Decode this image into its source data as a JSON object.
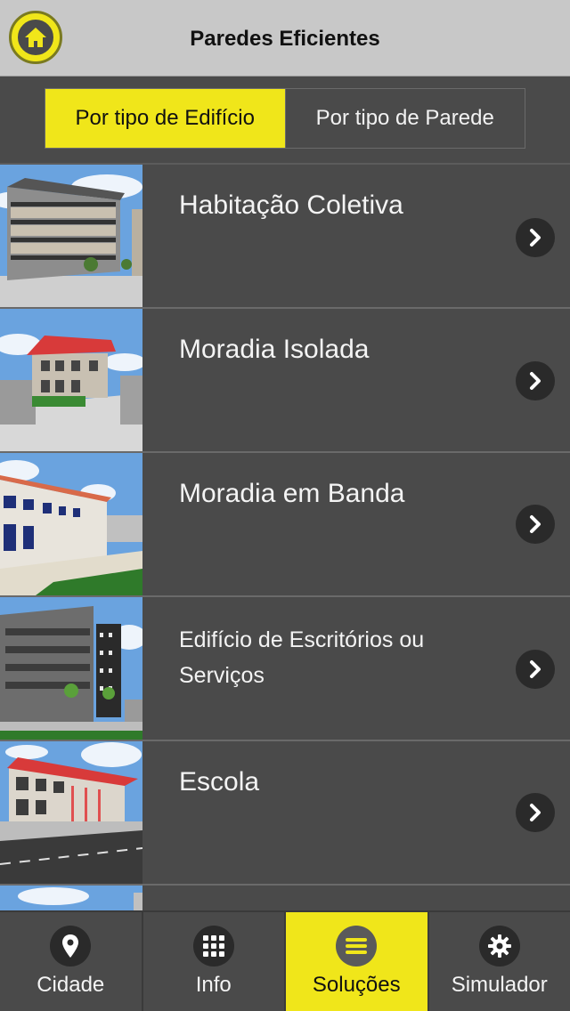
{
  "header": {
    "title": "Paredes Eficientes",
    "home_icon": "home-icon"
  },
  "segment": {
    "options": [
      {
        "label": "Por tipo de Edifício",
        "selected": true
      },
      {
        "label": "Por tipo de Parede",
        "selected": false
      }
    ]
  },
  "list": {
    "items": [
      {
        "label": "Habitação Coletiva",
        "thumb": "apartment-building"
      },
      {
        "label": "Moradia Isolada",
        "thumb": "detached-house"
      },
      {
        "label": "Moradia em Banda",
        "thumb": "row-houses"
      },
      {
        "label": "Edifício de Escritórios ou Serviços",
        "thumb": "office-building"
      },
      {
        "label": "Escola",
        "thumb": "school"
      }
    ]
  },
  "tabbar": {
    "tabs": [
      {
        "label": "Cidade",
        "icon": "map-pin-icon",
        "active": false
      },
      {
        "label": "Info",
        "icon": "grid-icon",
        "active": false
      },
      {
        "label": "Soluções",
        "icon": "list-icon",
        "active": true
      },
      {
        "label": "Simulador",
        "icon": "gear-icon",
        "active": false
      }
    ]
  },
  "colors": {
    "accent": "#f0e61a",
    "background": "#4a4a4a",
    "header": "#c8c8c8"
  }
}
